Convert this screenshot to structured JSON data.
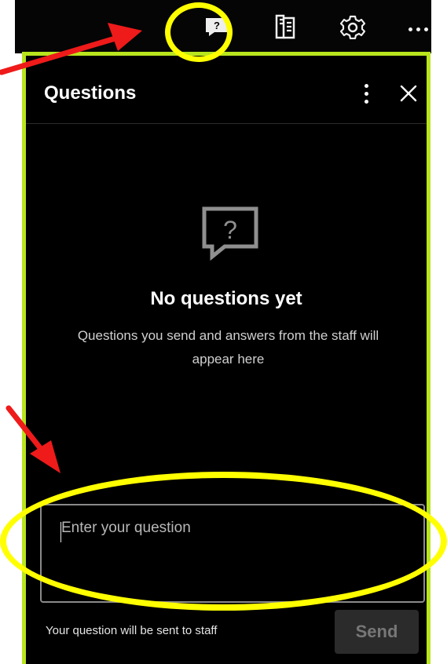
{
  "toolbar": {
    "icons": [
      {
        "name": "question-icon"
      },
      {
        "name": "document-list-icon"
      },
      {
        "name": "gear-icon"
      },
      {
        "name": "more-icon"
      }
    ]
  },
  "questions_panel": {
    "title": "Questions",
    "empty_state": {
      "title": "No questions yet",
      "description": "Questions you send and answers from the staff will appear here"
    },
    "question_input": {
      "value": "",
      "placeholder": "Enter your question"
    },
    "helper_text": "Your question will be sent to staff",
    "send_label": "Send"
  },
  "colors": {
    "panel_background": "#000000",
    "panel_border": "#b8e51d",
    "annotation_highlight": "#ffff00",
    "annotation_arrow": "#ef1a1a",
    "disabled_send_background": "#2b2b2b",
    "disabled_send_text": "#777777"
  }
}
